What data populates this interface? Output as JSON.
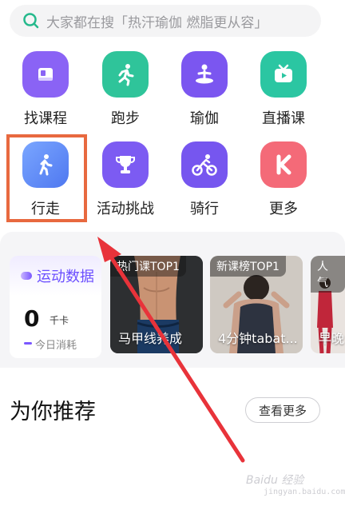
{
  "search": {
    "placeholder": "大家都在搜「热汗瑜伽 燃脂更从容」",
    "icon": "search-icon"
  },
  "categories": [
    {
      "label": "找课程",
      "icon": "course-book-icon",
      "color": "#8a63f5"
    },
    {
      "label": "跑步",
      "icon": "running-person-icon",
      "color": "#2fc49a"
    },
    {
      "label": "瑜伽",
      "icon": "yoga-meditation-icon",
      "color": "#7b56f0"
    },
    {
      "label": "直播课",
      "icon": "tv-live-icon",
      "color": "#2bc6a2"
    },
    {
      "label": "行走",
      "icon": "walking-person-icon",
      "color": "#5b87f7"
    },
    {
      "label": "活动挑战",
      "icon": "trophy-icon",
      "color": "#7c5bf2"
    },
    {
      "label": "骑行",
      "icon": "cycling-icon",
      "color": "#7656ef"
    },
    {
      "label": "更多",
      "icon": "more-k-icon",
      "color": "#f46a78"
    }
  ],
  "highlight_color": "#e8693f",
  "stats": {
    "title": "运动数据",
    "value": "0",
    "unit": "千卡",
    "caption": "今日消耗",
    "accent": "#6b4fff"
  },
  "cards": [
    {
      "tag": "热门课TOP1",
      "caption": "马甲线养成"
    },
    {
      "tag": "新课榜TOP1",
      "caption": "4分钟tabat..."
    },
    {
      "tag": "人气",
      "caption": "早晚"
    }
  ],
  "recommend": {
    "title": "为你推荐",
    "more_label": "查看更多"
  },
  "watermark": {
    "logo": "Baidu 经验",
    "url": "jingyan.baidu.com"
  }
}
